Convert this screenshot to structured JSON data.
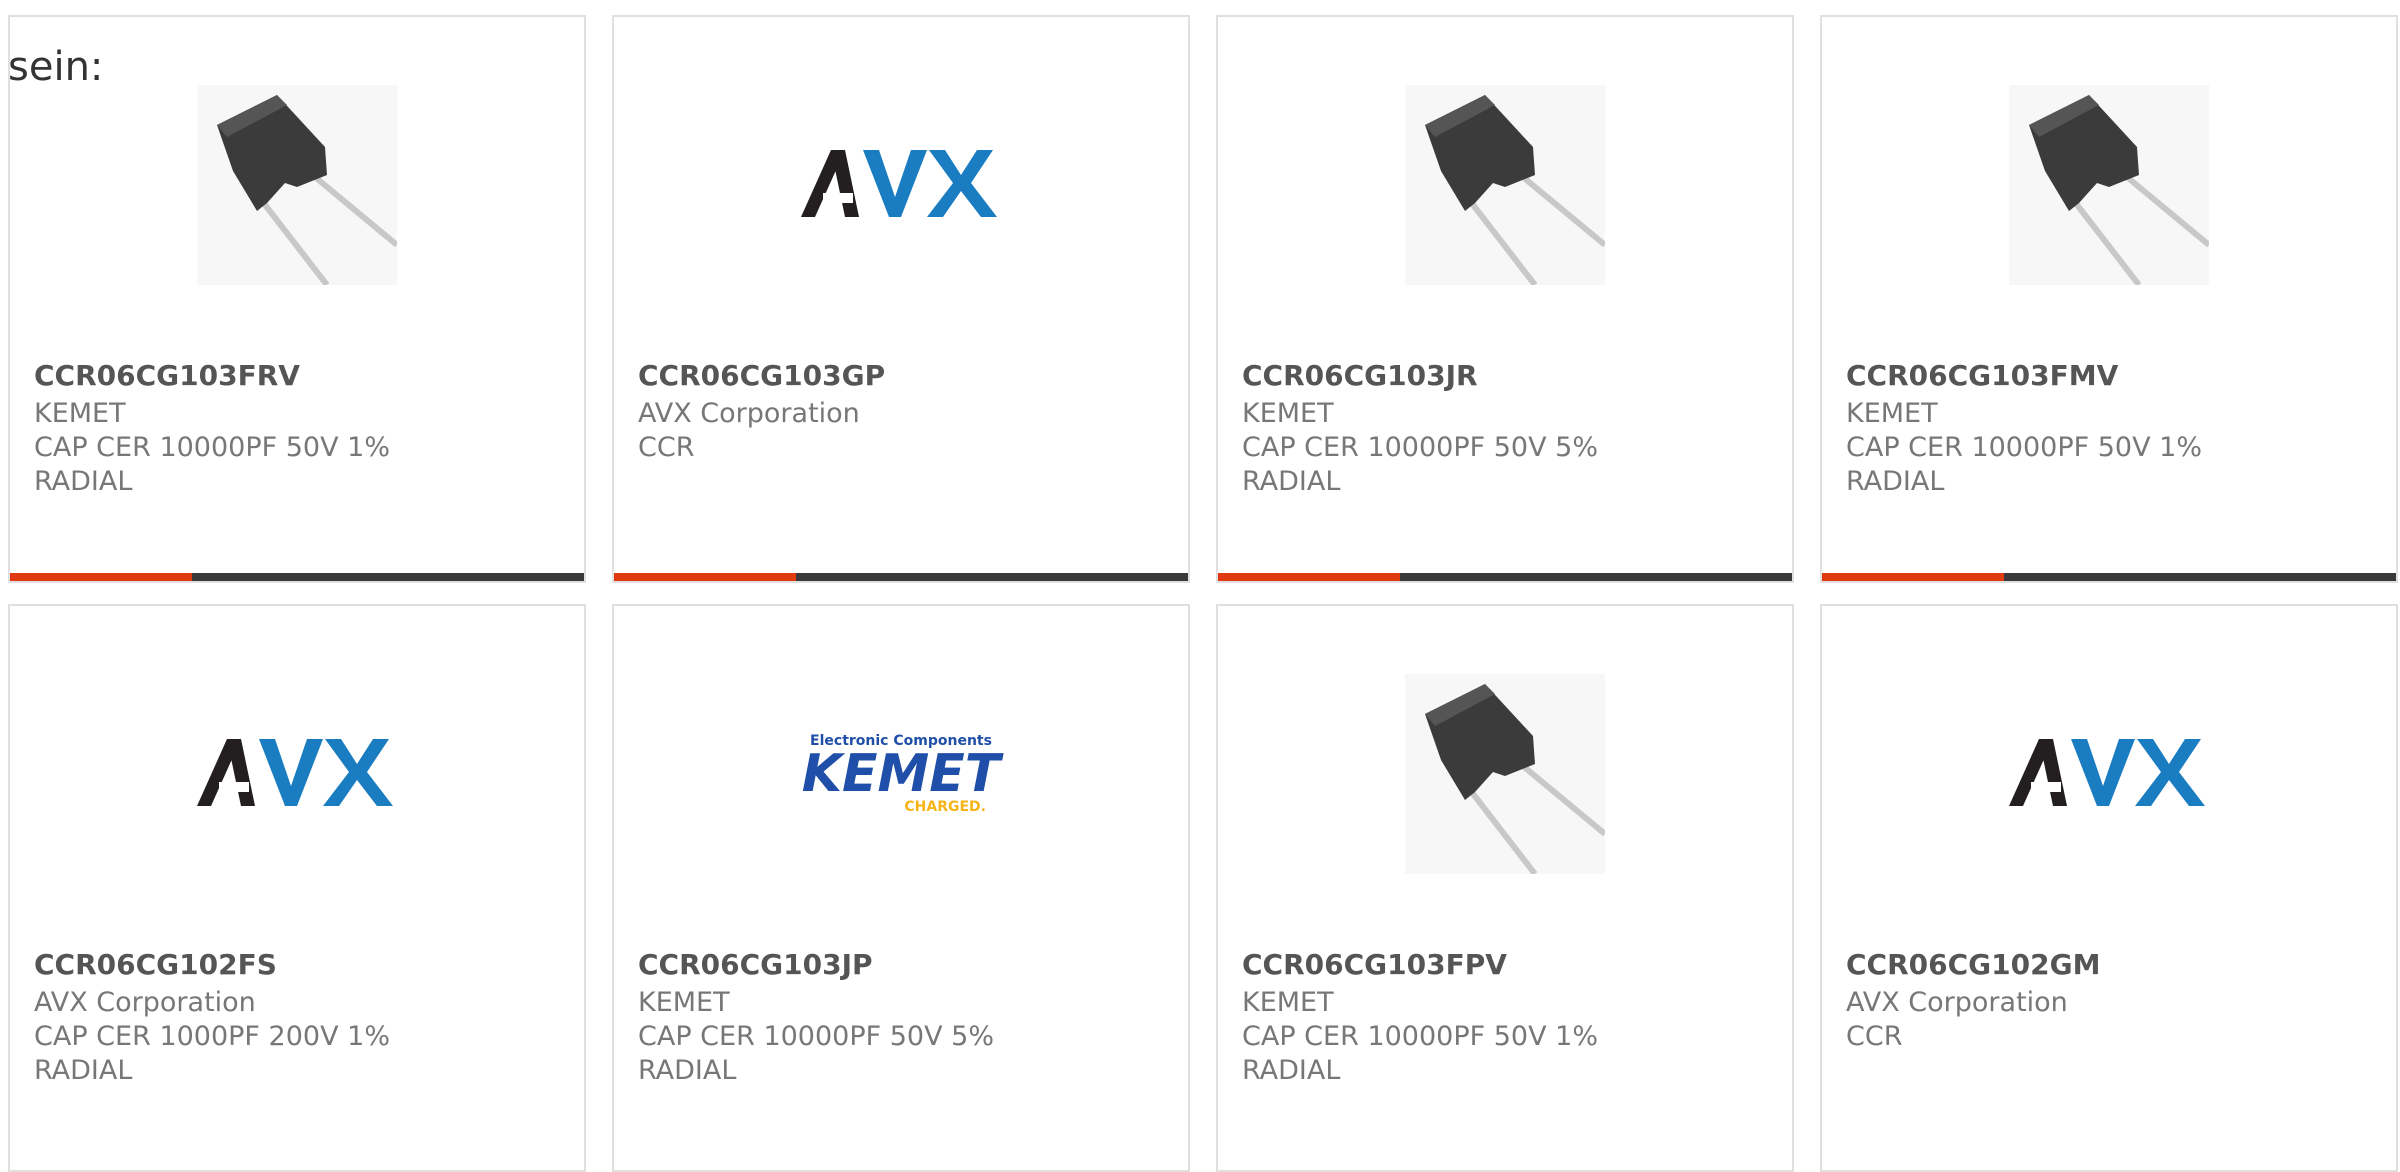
{
  "lead_text": "sein:",
  "colors": {
    "accent_bar": "#e03a10",
    "bar_base": "#3a3a3a",
    "avx_dark": "#231f20",
    "avx_blue": "#1a7cc1",
    "kemet_blue": "#1f4fa8",
    "kemet_yellow": "#f6b416"
  },
  "products": [
    {
      "part_number": "CCR06CG103FRV",
      "manufacturer": "KEMET",
      "description": "CAP CER 10000PF 50V 1% RADIAL",
      "image": "capacitor-photo"
    },
    {
      "part_number": "CCR06CG103GP",
      "manufacturer": "AVX Corporation",
      "description": "CCR",
      "image": "avx-logo"
    },
    {
      "part_number": "CCR06CG103JR",
      "manufacturer": "KEMET",
      "description": "CAP CER 10000PF 50V 5% RADIAL",
      "image": "capacitor-photo"
    },
    {
      "part_number": "CCR06CG103FMV",
      "manufacturer": "KEMET",
      "description": "CAP CER 10000PF 50V 1% RADIAL",
      "image": "capacitor-photo"
    },
    {
      "part_number": "CCR06CG102FS",
      "manufacturer": "AVX Corporation",
      "description": "CAP CER 1000PF 200V 1% RADIAL",
      "image": "avx-logo"
    },
    {
      "part_number": "CCR06CG103JP",
      "manufacturer": "KEMET",
      "description": "CAP CER 10000PF 50V 5% RADIAL",
      "image": "kemet-logo"
    },
    {
      "part_number": "CCR06CG103FPV",
      "manufacturer": "KEMET",
      "description": "CAP CER 10000PF 50V 1% RADIAL",
      "image": "capacitor-photo"
    },
    {
      "part_number": "CCR06CG102GM",
      "manufacturer": "AVX Corporation",
      "description": "CCR",
      "image": "avx-logo"
    }
  ],
  "logos": {
    "avx_text": "AVX",
    "kemet_text": "KEMET",
    "kemet_top": "Electronic Components",
    "kemet_bottom": "CHARGED."
  }
}
